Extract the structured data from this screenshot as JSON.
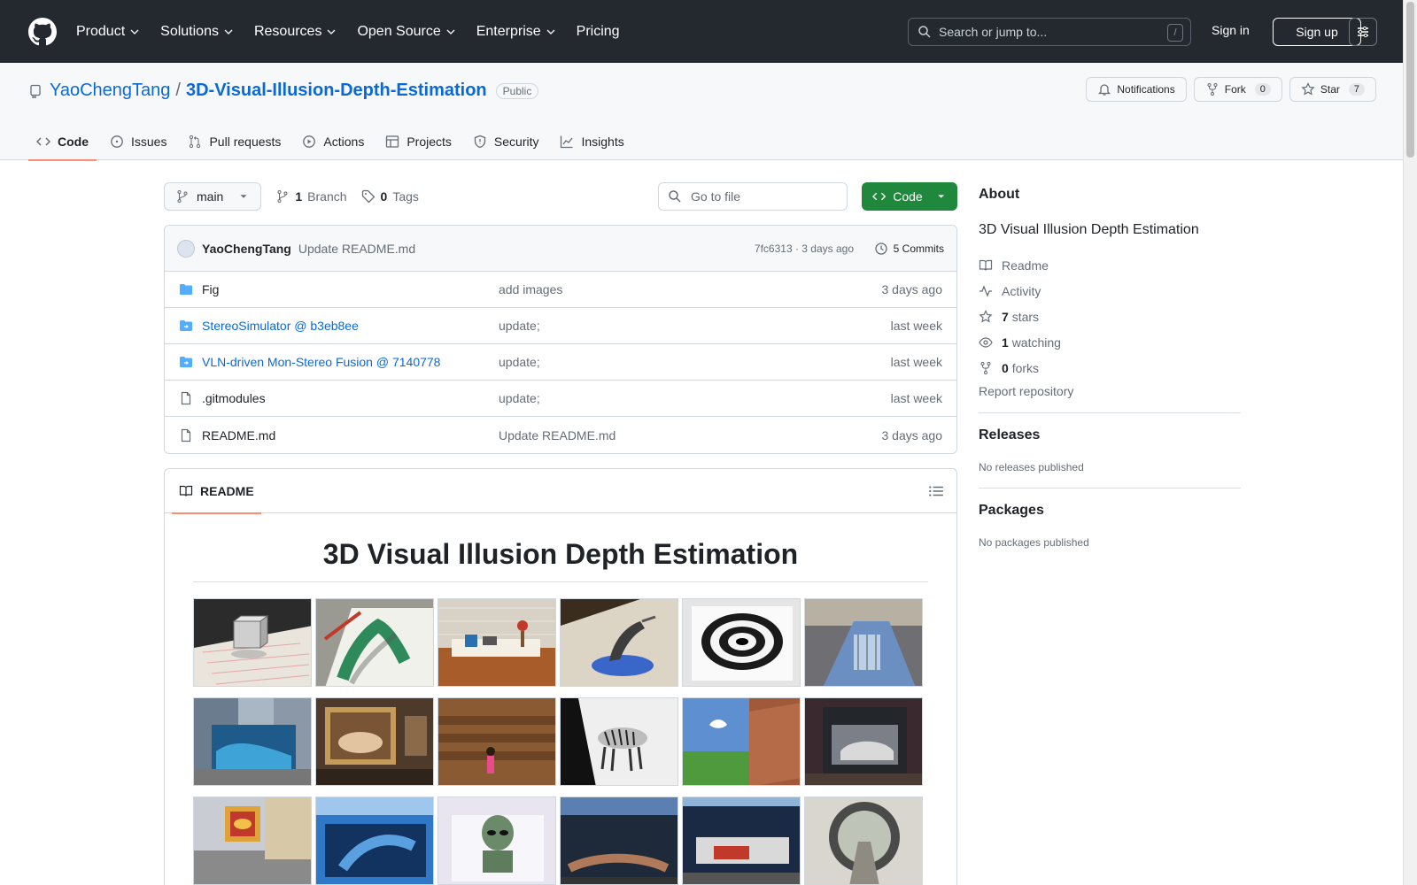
{
  "header": {
    "nav": [
      "Product",
      "Solutions",
      "Resources",
      "Open Source",
      "Enterprise",
      "Pricing"
    ],
    "search_placeholder": "Search or jump to...",
    "search_key": "/",
    "sign_in": "Sign in",
    "sign_up": "Sign up"
  },
  "repo": {
    "owner": "YaoChengTang",
    "separator": "/",
    "name": "3D-Visual-Illusion-Depth-Estimation",
    "visibility": "Public",
    "notifications_label": "Notifications",
    "fork_label": "Fork",
    "fork_count": "0",
    "star_label": "Star",
    "star_count": "7"
  },
  "tabs": [
    "Code",
    "Issues",
    "Pull requests",
    "Actions",
    "Projects",
    "Security",
    "Insights"
  ],
  "toolbar": {
    "branch": "main",
    "branches_count": "1",
    "branches_label": "Branch",
    "tags_count": "0",
    "tags_label": "Tags",
    "goto_placeholder": "Go to file",
    "code_button": "Code"
  },
  "commit": {
    "author": "YaoChengTang",
    "message": "Update README.md",
    "sha_time": "7fc6313 · 3 days ago",
    "commits": "5 Commits"
  },
  "files": [
    {
      "name": "Fig",
      "message": "add images",
      "date": "3 days ago"
    },
    {
      "name": "StereoSimulator @ b3eb8ee",
      "message": "update;",
      "date": "last week"
    },
    {
      "name": "VLN-driven Mon-Stereo Fusion @ 7140778",
      "message": "update;",
      "date": "last week"
    },
    {
      "name": ".gitmodules",
      "message": "update;",
      "date": "last week"
    },
    {
      "name": "README.md",
      "message": "Update README.md",
      "date": "3 days ago"
    }
  ],
  "readme": {
    "tab_label": "README",
    "title": "3D Visual Illusion Depth Estimation"
  },
  "about": {
    "heading": "About",
    "description": "3D Visual Illusion Depth Estimation",
    "readme": "Readme",
    "activity": "Activity",
    "stars_count": "7",
    "stars_label": "stars",
    "watching_count": "1",
    "watching_label": "watching",
    "forks_count": "0",
    "forks_label": "forks",
    "report": "Report repository"
  },
  "releases": {
    "heading": "Releases",
    "empty": "No releases published"
  },
  "packages": {
    "heading": "Packages",
    "empty": "No packages published"
  },
  "colors": {
    "header_bg": "#24292f",
    "link": "#0969da",
    "primary_button": "#1f883d",
    "tab_underline": "#fd8c73"
  }
}
